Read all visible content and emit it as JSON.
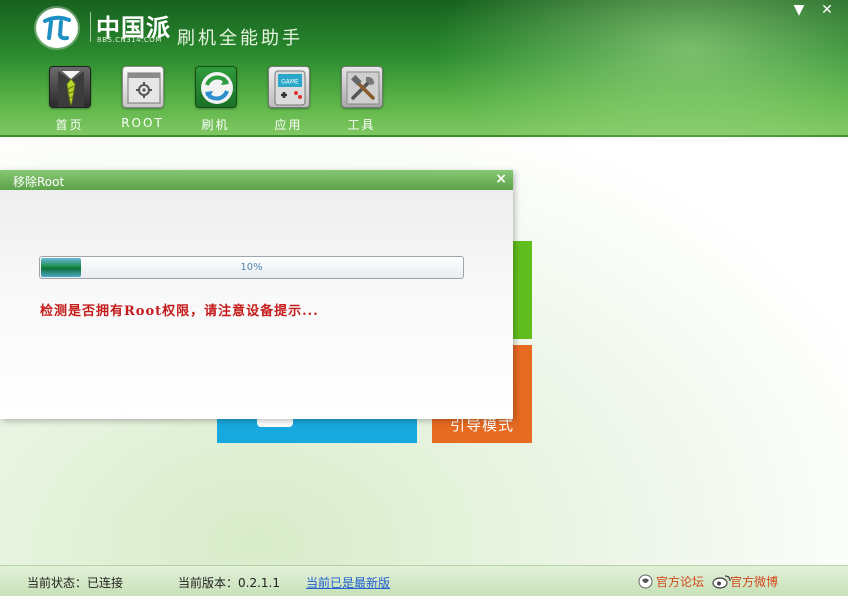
{
  "app": {
    "logo_text": "中国派",
    "logo_sub": "BBS.CN314.COM",
    "title": "刷机全能助手"
  },
  "window_controls": {
    "minimize_icon": "▼",
    "close_icon": "✕"
  },
  "nav": {
    "items": [
      {
        "label": "首页",
        "icon": "tie-icon"
      },
      {
        "label": "ROOT",
        "icon": "root-window-icon"
      },
      {
        "label": "刷机",
        "icon": "refresh-icon"
      },
      {
        "label": "应用",
        "icon": "gamepad-icon"
      },
      {
        "label": "工具",
        "icon": "tools-icon"
      }
    ]
  },
  "tiles": {
    "orange_label": "引导模式"
  },
  "dialog": {
    "title": "移除Root",
    "close_icon": "×",
    "progress": {
      "value": 0.1,
      "text": "10%"
    },
    "message": "检测是否拥有Root权限，请注意设备提示..."
  },
  "statusbar": {
    "connection": "当前状态：已连接",
    "version": "当前版本：0.2.1.1",
    "update_link": "当前已是最新版",
    "forum_link": "官方论坛",
    "weibo_link": "官方微博"
  },
  "colors": {
    "header_dark": "#17611f",
    "header_light": "#82c864",
    "tile_green": "#62be1f",
    "tile_orange": "#e76a21",
    "tile_blue": "#17a8de",
    "message_red": "#c51b1b"
  }
}
